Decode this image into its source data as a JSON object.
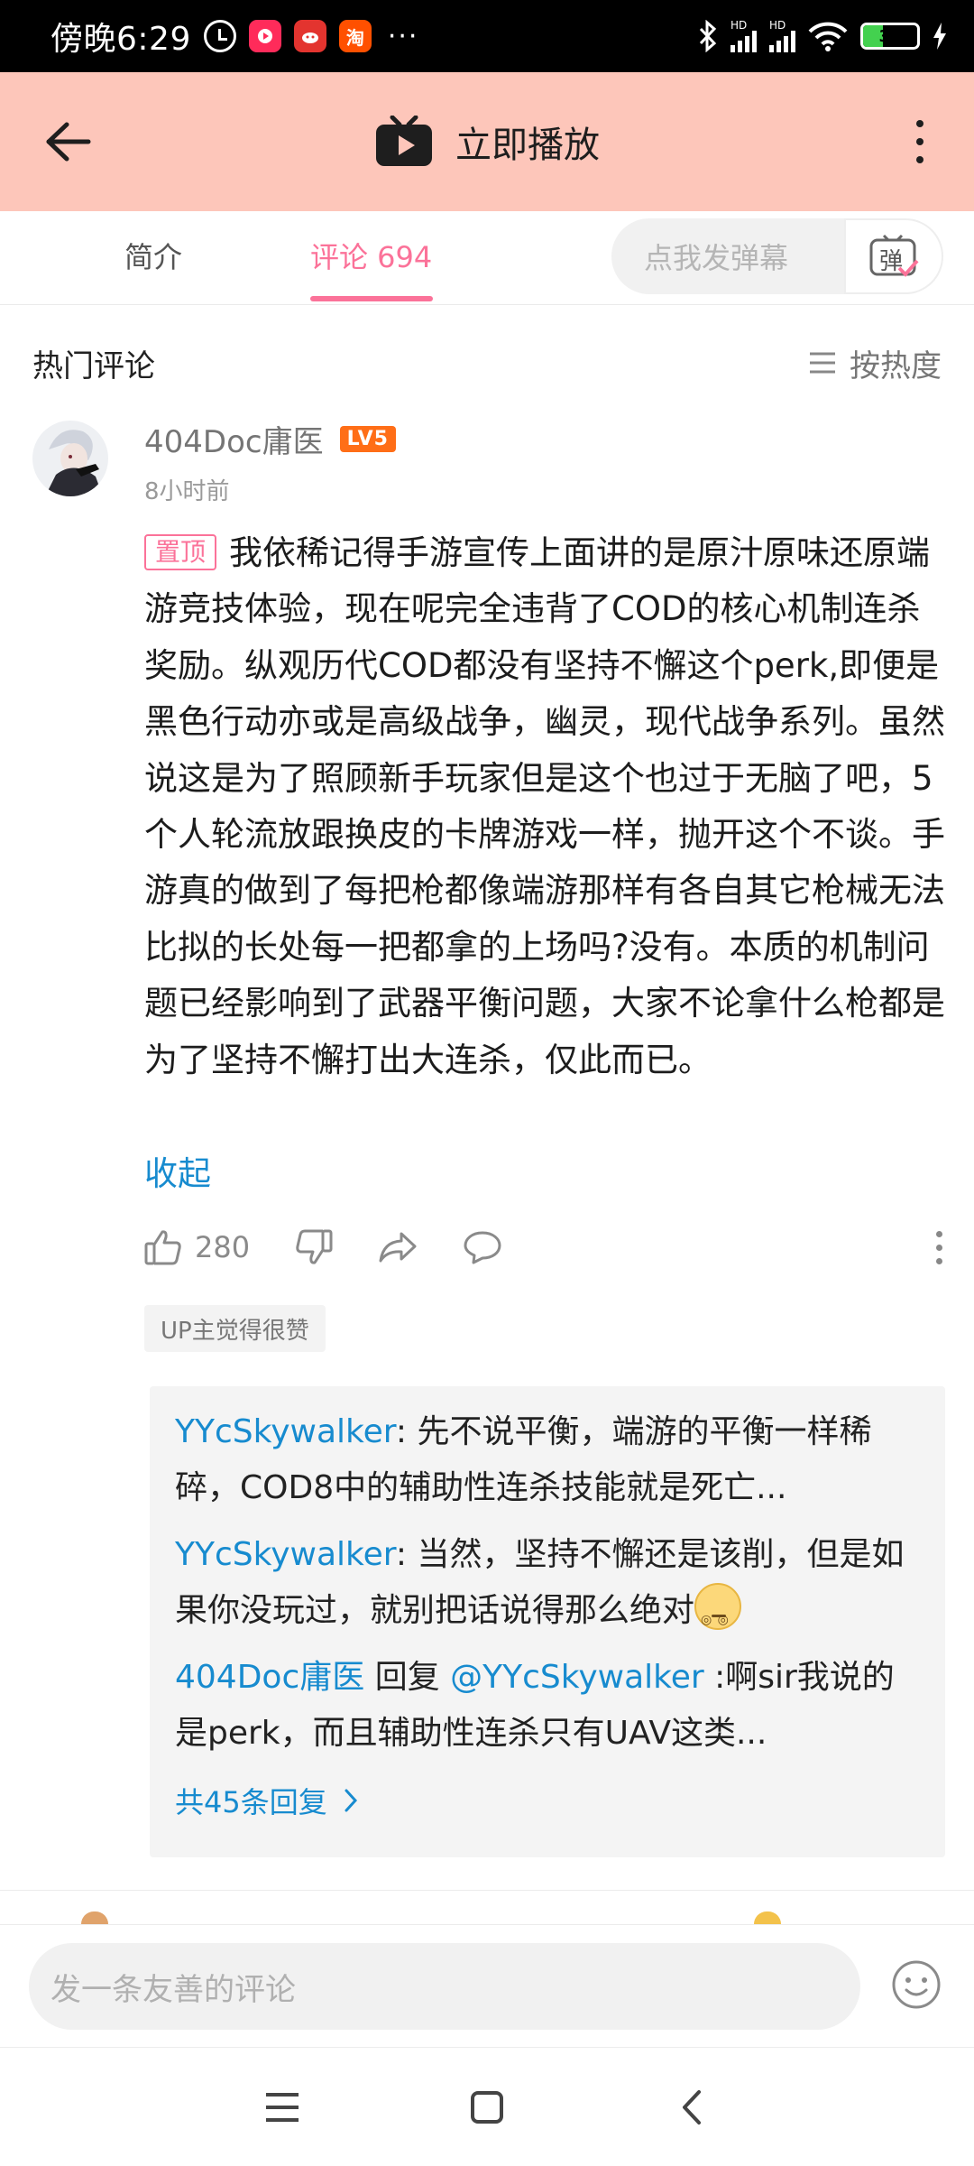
{
  "status_bar": {
    "time": "傍晚6:29",
    "more": "···",
    "battery_level": "37",
    "network_labels": [
      "HD",
      "HD"
    ],
    "app_badge_taobao": "淘"
  },
  "header": {
    "title": "立即播放"
  },
  "tabs": {
    "intro": "简介",
    "comments": "评论 694",
    "danmaku_placeholder": "点我发弹幕",
    "danmaku_toggle": "弹"
  },
  "section": {
    "title": "热门评论",
    "sort_label": "按热度"
  },
  "comment": {
    "username": "404Doc庸医",
    "level": "LV5",
    "time": "8小时前",
    "pin_tag": "置顶",
    "text": "我依稀记得手游宣传上面讲的是原汁原味还原端游竞技体验，现在呢完全违背了COD的核心机制连杀奖励。纵观历代COD都没有坚持不懈这个perk,即便是黑色行动亦或是高级战争，幽灵，现代战争系列。虽然说这是为了照顾新手玩家但是这个也过于无脑了吧，5个人轮流放跟换皮的卡牌游戏一样，抛开这个不谈。手游真的做到了每把枪都像端游那样有各自其它枪械无法比拟的长处每一把都拿的上场吗?没有。本质的机制问题已经影响到了武器平衡问题，大家不论拿什么枪都是为了坚持不懈打出大连杀，仅此而已。",
    "collapse": "收起",
    "likes": "280",
    "up_badge": "UP主觉得很赞"
  },
  "replies": [
    {
      "user": "YYcSkywalker",
      "sep": ": ",
      "text": "先不说平衡，端游的平衡一样稀碎，COD8中的辅助性连杀技能就是死亡..."
    },
    {
      "user": "YYcSkywalker",
      "sep": ": ",
      "text": "当然，坚持不懈还是该削，但是如果你没玩过，就别把话说得那么绝对"
    },
    {
      "user": "404Doc庸医",
      "reply_word": " 回复 ",
      "mention": "@YYcSkywalker",
      "text": " :啊sir我说的是perk，而且辅助性连杀只有UAV这类..."
    }
  ],
  "replies_more": "共45条回复",
  "bottom": {
    "comment_placeholder": "发一条友善的评论"
  },
  "colors": {
    "accent_pink": "#fb7299",
    "link_blue": "#178bcf",
    "header_bg": "#fdc6ba",
    "level_orange": "#ff6e17"
  },
  "icons": {
    "back": "arrow-left-icon",
    "tv": "tv-icon",
    "more": "more-vertical-icon",
    "sort": "list-icon",
    "like": "thumb-up-icon",
    "dislike": "thumb-down-icon",
    "share": "share-icon",
    "reply": "chat-bubble-icon",
    "emoji": "smiley-icon"
  }
}
